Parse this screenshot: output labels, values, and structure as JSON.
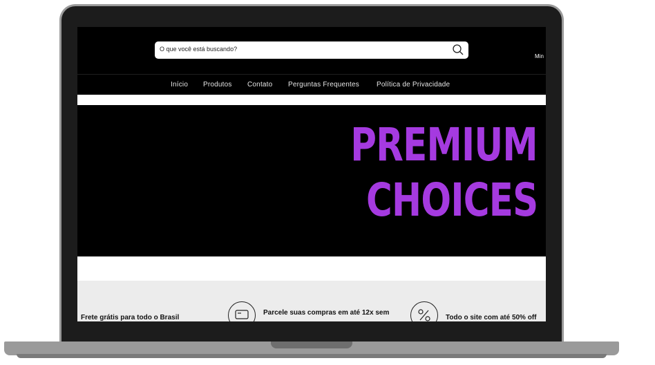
{
  "search": {
    "placeholder": "O que você está buscando?"
  },
  "header": {
    "account_label": "Min"
  },
  "nav": {
    "items": [
      "Início",
      "Produtos",
      "Contato",
      "Perguntas Frequentes",
      "Política de Privacidade"
    ]
  },
  "banner": {
    "line1": "PREMIUM",
    "line2": "CHOICES",
    "accent_color": "#a53ae0"
  },
  "benefits": {
    "items": [
      {
        "text": "Frete grátis para todo o Brasil"
      },
      {
        "text": "Parcele suas compras em até 12x sem",
        "icon": "card-icon"
      },
      {
        "text": "Todo o site com até 50% off",
        "icon": "percent-icon"
      }
    ]
  }
}
